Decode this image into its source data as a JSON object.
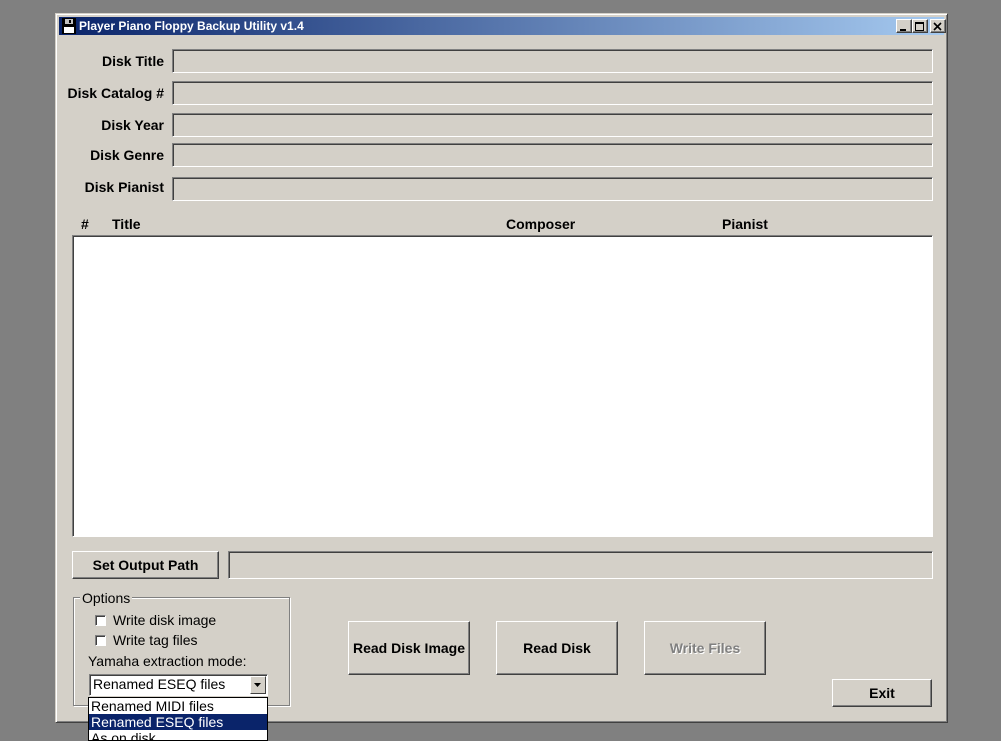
{
  "window": {
    "title": "Player Piano Floppy Backup Utility v1.4"
  },
  "fields": [
    {
      "label": "Disk Title",
      "value": ""
    },
    {
      "label": "Disk Catalog #",
      "value": ""
    },
    {
      "label": "Disk Year",
      "value": ""
    },
    {
      "label": "Disk Genre",
      "value": ""
    },
    {
      "label": "Disk Pianist",
      "value": ""
    }
  ],
  "tracks": {
    "columns": [
      "#",
      "Title",
      "Composer",
      "Pianist"
    ],
    "rows": []
  },
  "output": {
    "button": "Set Output Path",
    "path": ""
  },
  "options": {
    "legend": "Options",
    "write_disk_image": {
      "label": "Write disk image",
      "checked": false
    },
    "write_tag_files": {
      "label": "Write tag files",
      "checked": false
    },
    "mode_label": "Yamaha extraction mode:",
    "mode_selected": "Renamed ESEQ files",
    "mode_options": [
      "Renamed MIDI files",
      "Renamed ESEQ files",
      "As on disk"
    ]
  },
  "actions": {
    "read_disk_image": "Read Disk Image",
    "read_disk": "Read Disk",
    "write_files": "Write Files",
    "exit": "Exit"
  }
}
